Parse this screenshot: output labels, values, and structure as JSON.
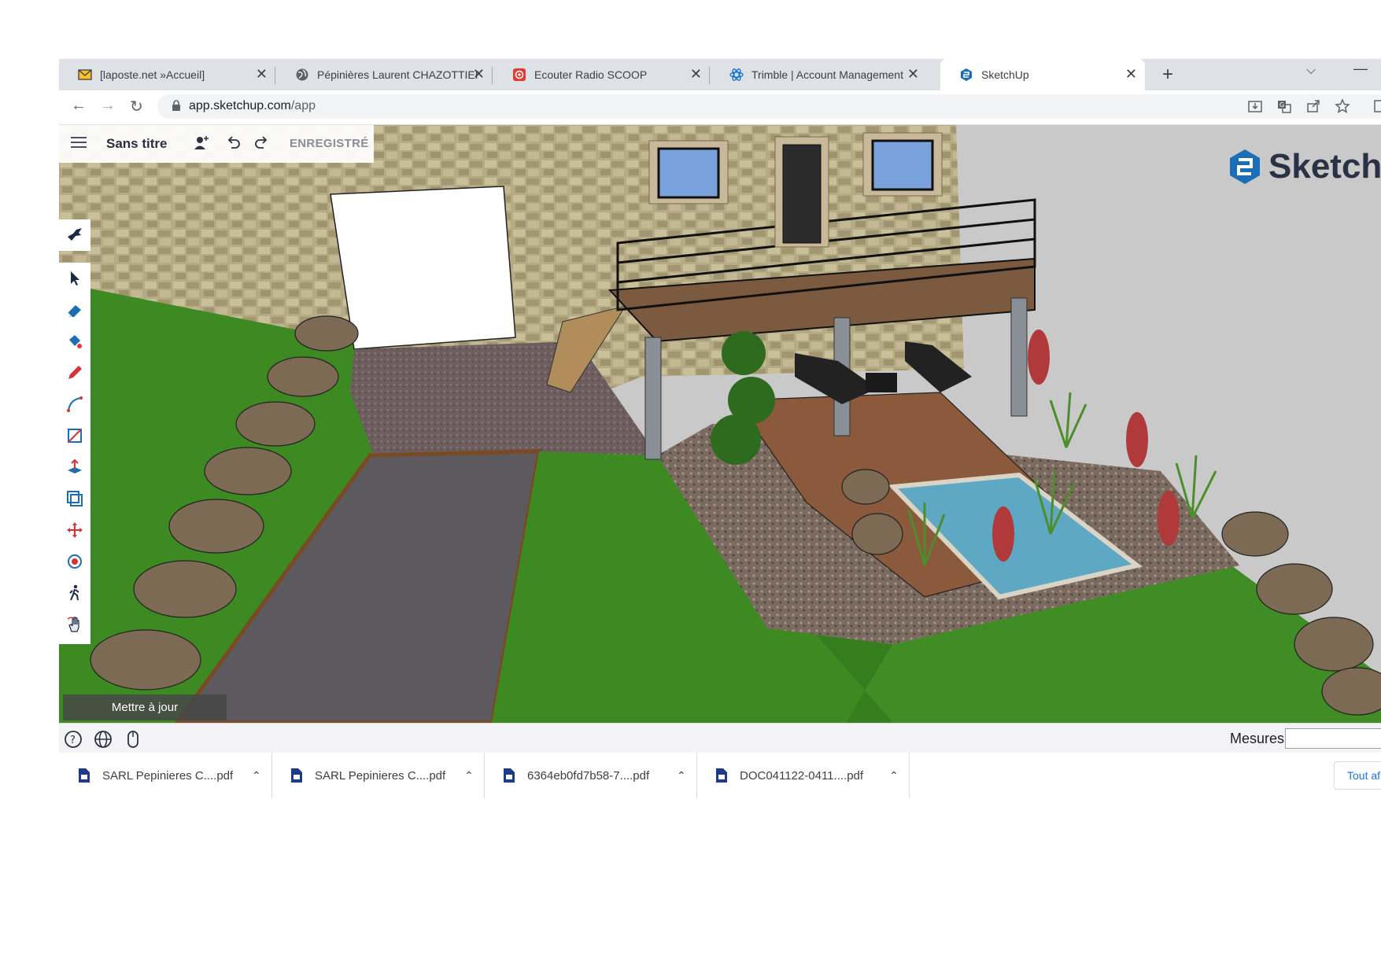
{
  "browser": {
    "tabs": [
      {
        "title": "[laposte.net »Accueil]",
        "icon": "mail-icon"
      },
      {
        "title": "Pépinières Laurent CHAZOTTIER",
        "icon": "globe-icon"
      },
      {
        "title": "Ecouter Radio SCOOP",
        "icon": "radio-icon"
      },
      {
        "title": "Trimble | Account Management",
        "icon": "trimble-icon"
      },
      {
        "title": "SketchUp",
        "icon": "sketchup-icon",
        "active": true
      }
    ],
    "url_host": "app.sketchup.com",
    "url_path": "/app"
  },
  "app": {
    "doc_title": "Sans titre",
    "save_status": "ENREGISTRÉ",
    "logo_text": "SketchU",
    "update_button": "Mettre à jour",
    "tools": [
      "select-icon",
      "eraser-icon",
      "paint-bucket-icon",
      "pencil-icon",
      "arc-icon",
      "rectangle-icon",
      "push-pull-icon",
      "offset-icon",
      "move-icon",
      "orbit-icon",
      "walk-icon",
      "hand-icon"
    ]
  },
  "statusbar": {
    "measures_label": "Mesures",
    "measures_value": ""
  },
  "downloads": {
    "items": [
      "SARL Pepinieres C....pdf",
      "SARL Pepinieres C....pdf",
      "6364eb0fd7b58-7....pdf",
      "DOC041122-0411....pdf"
    ],
    "show_all": "Tout af"
  },
  "colors": {
    "tabstrip": "#dee1e6",
    "sketchup_blue": "#1b6eb5",
    "grass": "#3d8a22",
    "stone_wall": "#b0a57f",
    "deck": "#8b5a3c",
    "pool": "#5ea8c4"
  }
}
